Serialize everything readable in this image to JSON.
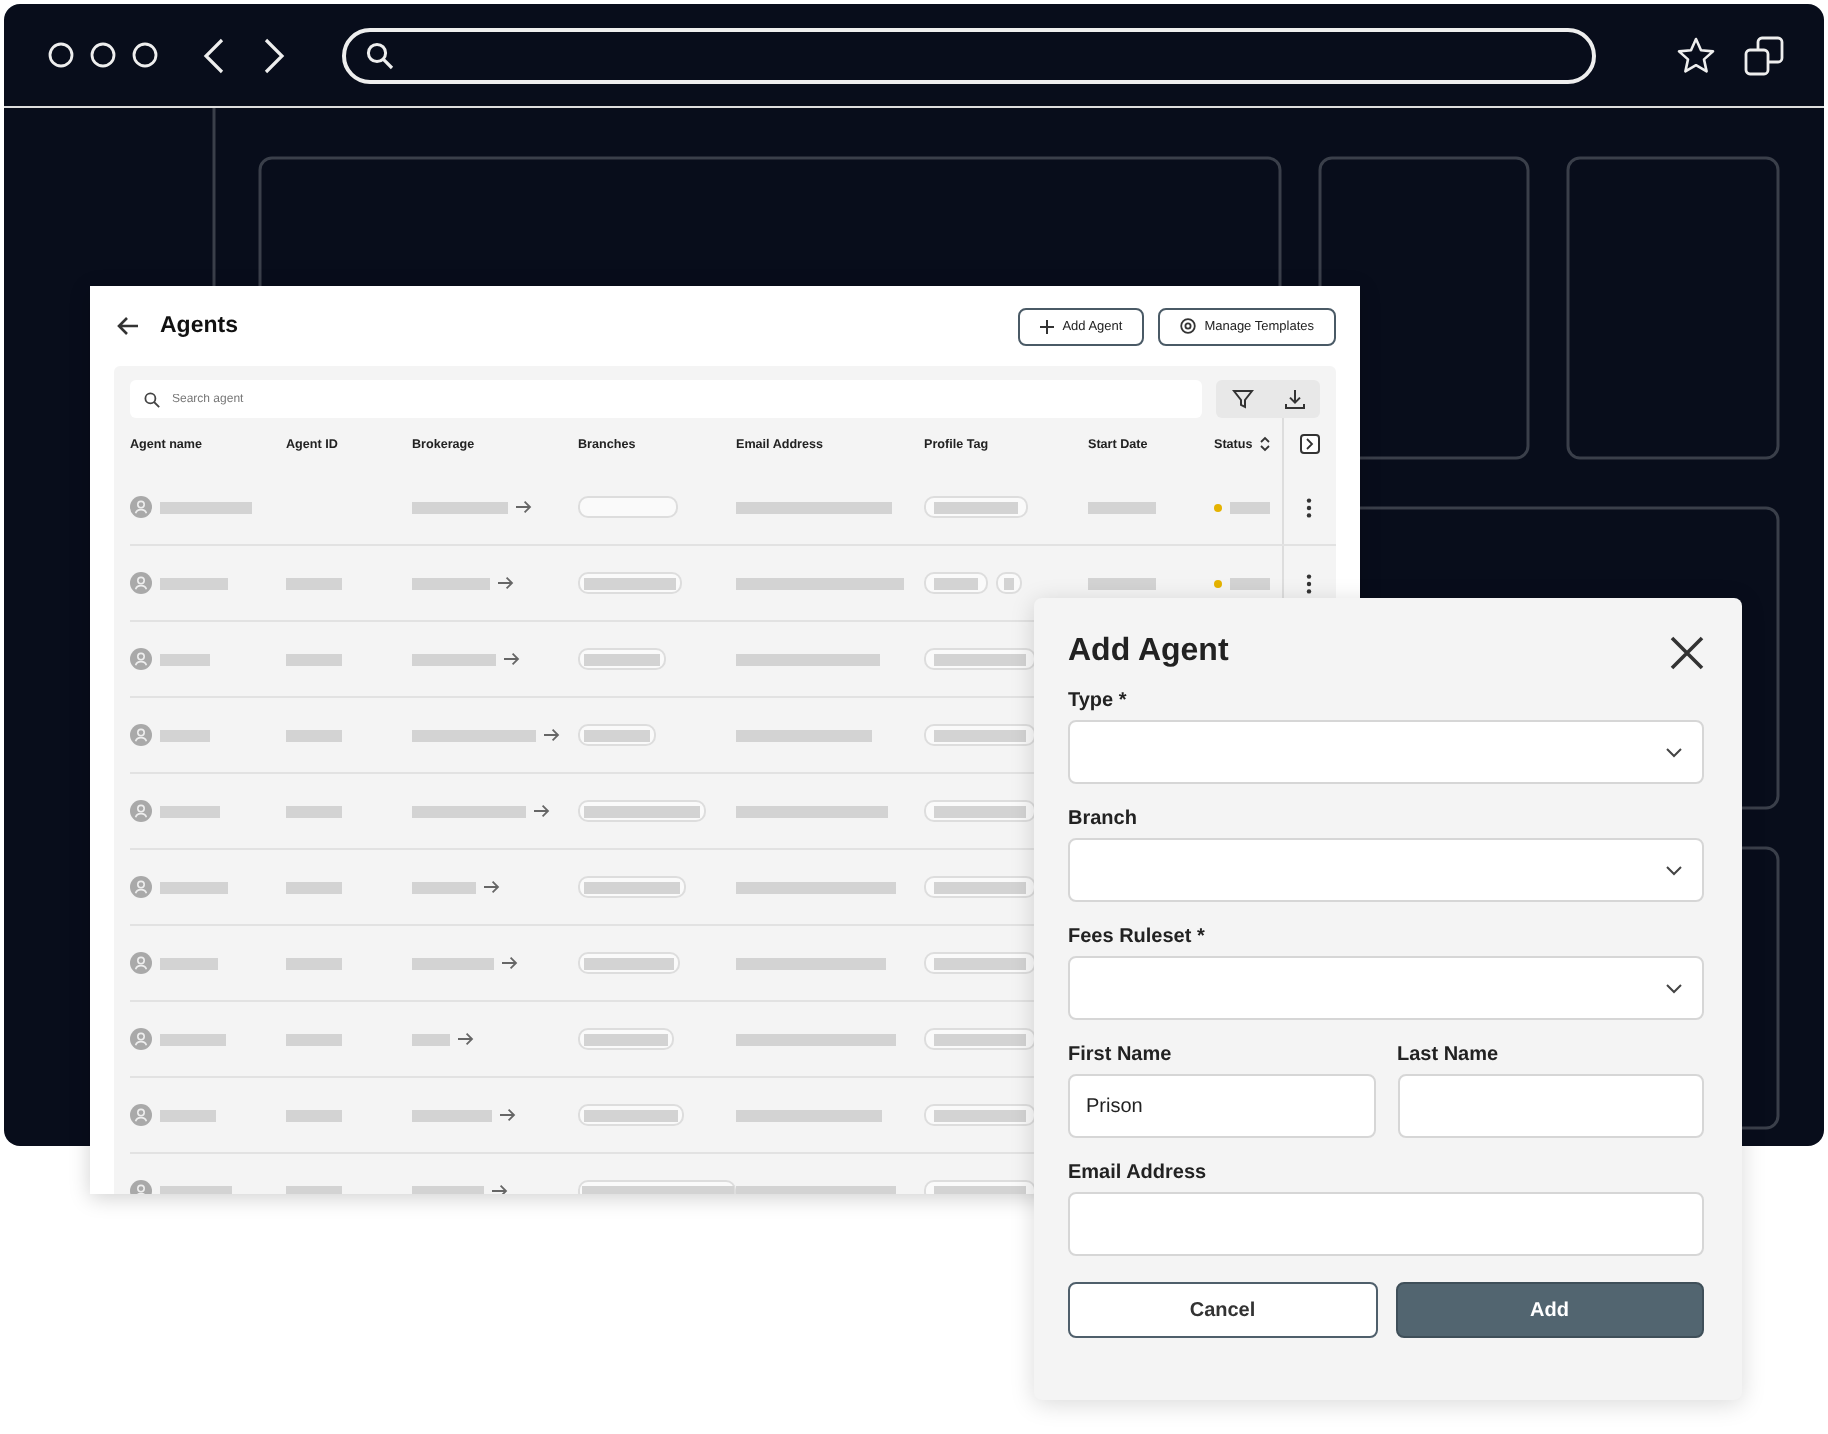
{
  "agents_page": {
    "title": "Agents",
    "buttons": [
      {
        "kind": "add",
        "label": "Add Agent"
      },
      {
        "kind": "templates",
        "label": "Manage Templates"
      }
    ],
    "search": {
      "placeholder": "Search agent"
    },
    "table": {
      "columns": [
        {
          "label": "Agent name",
          "sortable": false
        },
        {
          "label": "Agent ID",
          "sortable": false
        },
        {
          "label": "Brokerage",
          "sortable": false
        },
        {
          "label": "Branches",
          "sortable": false
        },
        {
          "label": "Email Address",
          "sortable": false
        },
        {
          "label": "Profile Tag",
          "sortable": false
        },
        {
          "label": "Start Date",
          "sortable": false
        },
        {
          "label": "Status",
          "sortable": true
        }
      ],
      "rows": [
        {
          "kind": "skeleton",
          "status": {
            "color": "#e5b301"
          },
          "menu": true
        },
        {
          "kind": "skeleton",
          "status": {
            "color": "#e5b301"
          },
          "menu": true
        },
        {
          "kind": "skeleton"
        },
        {
          "kind": "skeleton"
        },
        {
          "kind": "skeleton"
        },
        {
          "kind": "skeleton"
        },
        {
          "kind": "skeleton"
        },
        {
          "kind": "skeleton"
        },
        {
          "kind": "skeleton"
        },
        {
          "kind": "skeleton"
        }
      ]
    }
  },
  "dialog": {
    "title": "Add Agent",
    "field_rows": [
      [
        {
          "kind": "select",
          "label": "Type *"
        }
      ],
      [
        {
          "kind": "select",
          "label": "Branch"
        }
      ],
      [
        {
          "kind": "select",
          "label": "Fees Ruleset *"
        }
      ],
      [
        {
          "kind": "text",
          "label": "First Name",
          "value": "Prison"
        },
        {
          "kind": "text",
          "label": "Last Name"
        }
      ],
      [
        {
          "kind": "text",
          "label": "Email Address"
        }
      ]
    ],
    "buttons": [
      {
        "kind": "secondary",
        "label": "Cancel"
      },
      {
        "kind": "primary",
        "label": "Add"
      }
    ]
  }
}
